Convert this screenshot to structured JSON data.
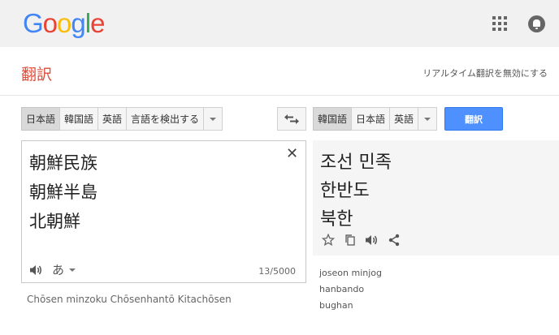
{
  "header": {
    "logo_letters": [
      {
        "ch": "G",
        "color": "#4285F4"
      },
      {
        "ch": "o",
        "color": "#EA4335"
      },
      {
        "ch": "o",
        "color": "#FBBC05"
      },
      {
        "ch": "g",
        "color": "#4285F4"
      },
      {
        "ch": "l",
        "color": "#34A853"
      },
      {
        "ch": "e",
        "color": "#EA4335"
      }
    ],
    "apps_icon": "apps-grid-icon",
    "notifications_icon": "bell-icon"
  },
  "titlebar": {
    "title": "翻訳",
    "realtime_link": "リアルタイム翻訳を無効にする"
  },
  "source": {
    "languages": [
      "日本語",
      "韓国語",
      "英語",
      "言語を検出する"
    ],
    "selected_index": 0,
    "lines": [
      "朝鮮民族",
      "朝鮮半島",
      "北朝鮮"
    ],
    "ime_label": "あ",
    "char_count": "13/5000",
    "romanization": "Chōsen minzoku Chōsenhantō Kitachōsen"
  },
  "target": {
    "languages": [
      "韓国語",
      "日本語",
      "英語"
    ],
    "selected_index": 0,
    "translate_button": "翻訳",
    "lines": [
      "조선 민족",
      "한반도",
      "북한"
    ],
    "romanization": [
      "joseon minjog",
      "hanbando",
      "bughan"
    ]
  },
  "colors": {
    "accent_blue": "#4d90fe",
    "title_red": "#dd4b39"
  }
}
